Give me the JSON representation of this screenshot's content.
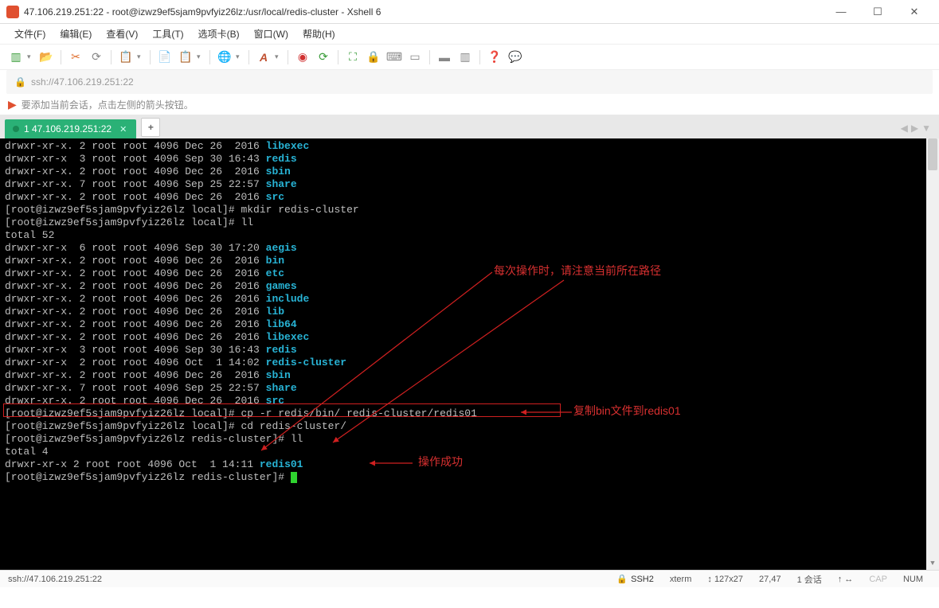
{
  "window": {
    "title": "47.106.219.251:22 - root@izwz9ef5sjam9pvfyiz26lz:/usr/local/redis-cluster - Xshell 6",
    "min": "—",
    "max": "☐",
    "close": "✕"
  },
  "menu": [
    "文件(F)",
    "编辑(E)",
    "查看(V)",
    "工具(T)",
    "选项卡(B)",
    "窗口(W)",
    "帮助(H)"
  ],
  "addr": "ssh://47.106.219.251:22",
  "tip": "要添加当前会话，点击左侧的箭头按钮。",
  "tab": {
    "label": "1 47.106.219.251:22",
    "add": "+"
  },
  "navarrows": [
    "◀",
    "▶",
    "▼"
  ],
  "term": {
    "l01a": "drwxr-xr-x. 2 root root 4096 Dec 26  2016 ",
    "l01b": "libexec",
    "l02a": "drwxr-xr-x  3 root root 4096 Sep 30 16:43 ",
    "l02b": "redis",
    "l03a": "drwxr-xr-x. 2 root root 4096 Dec 26  2016 ",
    "l03b": "sbin",
    "l04a": "drwxr-xr-x. 7 root root 4096 Sep 25 22:57 ",
    "l04b": "share",
    "l05a": "drwxr-xr-x. 2 root root 4096 Dec 26  2016 ",
    "l05b": "src",
    "l06": "[root@izwz9ef5sjam9pvfyiz26lz local]# mkdir redis-cluster",
    "l07": "[root@izwz9ef5sjam9pvfyiz26lz local]# ll",
    "l08": "total 52",
    "l09a": "drwxr-xr-x  6 root root 4096 Sep 30 17:20 ",
    "l09b": "aegis",
    "l10a": "drwxr-xr-x. 2 root root 4096 Dec 26  2016 ",
    "l10b": "bin",
    "l11a": "drwxr-xr-x. 2 root root 4096 Dec 26  2016 ",
    "l11b": "etc",
    "l12a": "drwxr-xr-x. 2 root root 4096 Dec 26  2016 ",
    "l12b": "games",
    "l13a": "drwxr-xr-x. 2 root root 4096 Dec 26  2016 ",
    "l13b": "include",
    "l14a": "drwxr-xr-x. 2 root root 4096 Dec 26  2016 ",
    "l14b": "lib",
    "l15a": "drwxr-xr-x. 2 root root 4096 Dec 26  2016 ",
    "l15b": "lib64",
    "l16a": "drwxr-xr-x. 2 root root 4096 Dec 26  2016 ",
    "l16b": "libexec",
    "l17a": "drwxr-xr-x  3 root root 4096 Sep 30 16:43 ",
    "l17b": "redis",
    "l18a": "drwxr-xr-x  2 root root 4096 Oct  1 14:02 ",
    "l18b": "redis-cluster",
    "l19a": "drwxr-xr-x. 2 root root 4096 Dec 26  2016 ",
    "l19b": "sbin",
    "l20a": "drwxr-xr-x. 7 root root 4096 Sep 25 22:57 ",
    "l20b": "share",
    "l21a": "drwxr-xr-x. 2 root root 4096 Dec 26  2016 ",
    "l21b": "src",
    "l22": "[root@izwz9ef5sjam9pvfyiz26lz local]# cp -r redis/bin/ redis-cluster/redis01",
    "l23": "[root@izwz9ef5sjam9pvfyiz26lz local]# cd redis-cluster/",
    "l24": "[root@izwz9ef5sjam9pvfyiz26lz redis-cluster]# ll",
    "l25": "total 4",
    "l26a": "drwxr-xr-x 2 root root 4096 Oct  1 14:11 ",
    "l26b": "redis01",
    "l27": "[root@izwz9ef5sjam9pvfyiz26lz redis-cluster]# "
  },
  "annot": {
    "a1": "每次操作时，请注意当前所在路径",
    "a2": "复制bin文件到redis01",
    "a3": "操作成功"
  },
  "status": {
    "addr": "ssh://47.106.219.251:22",
    "ssh": "SSH2",
    "term": "xterm",
    "size": "127x27",
    "pos": "27,47",
    "sess": "1 会话",
    "conn": "↑ ↔",
    "cap": "CAP",
    "num": "NUM"
  }
}
